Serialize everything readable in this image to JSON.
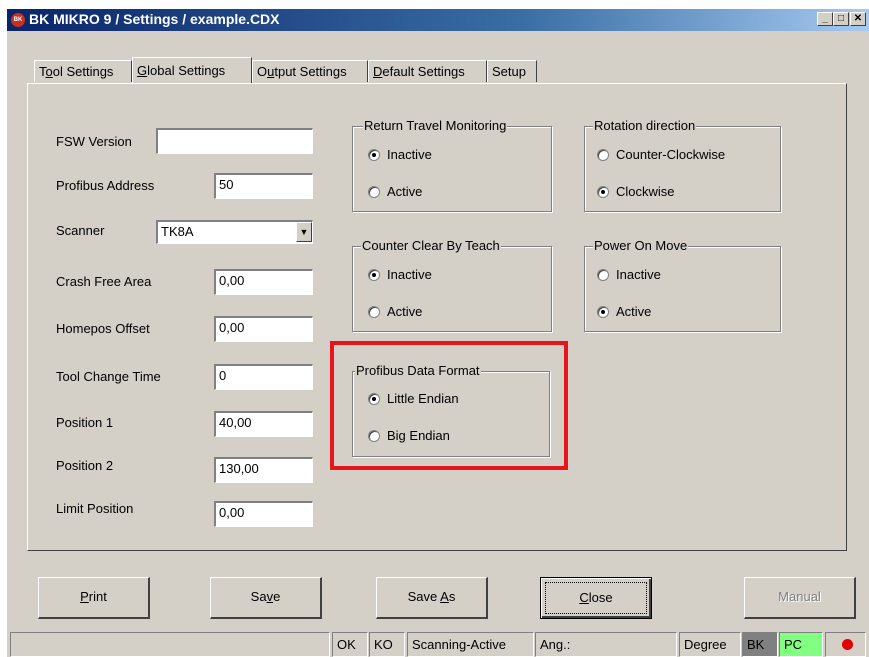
{
  "window": {
    "title": "BK MIKRO 9 / Settings / example.CDX",
    "icon": "bk-logo-icon",
    "minimize": "_",
    "maximize": "□",
    "close": "✕"
  },
  "tabs": [
    {
      "label": "Tool Settings",
      "mnemonic": "o"
    },
    {
      "label": "Global Settings",
      "mnemonic": "G"
    },
    {
      "label": "Output Settings",
      "mnemonic": "u"
    },
    {
      "label": "Default Settings",
      "mnemonic": "D"
    },
    {
      "label": "Setup"
    }
  ],
  "active_tab": "Global Settings",
  "fields": {
    "fsw_version": {
      "label": "FSW Version",
      "value": ""
    },
    "profibus_address": {
      "label": "Profibus Address",
      "value": "50"
    },
    "scanner": {
      "label": "Scanner",
      "value": "TK8A"
    },
    "crash_free_area": {
      "label": "Crash Free Area",
      "value": "0,00"
    },
    "homepos_offset": {
      "label": "Homepos Offset",
      "value": "0,00"
    },
    "tool_change_time": {
      "label": "Tool Change Time",
      "value": "0"
    },
    "position_1": {
      "label": "Position 1",
      "value": "40,00"
    },
    "position_2": {
      "label": "Position 2",
      "value": "130,00"
    },
    "limit_position": {
      "label": "Limit Position",
      "value": "0,00"
    }
  },
  "groups": {
    "return_travel": {
      "title": "Return Travel Monitoring",
      "options": [
        "Inactive",
        "Active"
      ],
      "selected": "Inactive"
    },
    "rotation": {
      "title": "Rotation direction",
      "options": [
        "Counter-Clockwise",
        "Clockwise"
      ],
      "selected": "Clockwise"
    },
    "counter_clear": {
      "title": "Counter Clear By Teach",
      "options": [
        "Inactive",
        "Active"
      ],
      "selected": "Inactive"
    },
    "power_on_move": {
      "title": "Power On Move",
      "options": [
        "Inactive",
        "Active"
      ],
      "selected": "Active"
    },
    "profibus_format": {
      "title": "Profibus Data Format",
      "options": [
        "Little Endian",
        "Big Endian"
      ],
      "selected": "Little Endian"
    }
  },
  "buttons": {
    "print": {
      "pre": "",
      "u": "P",
      "post": "rint"
    },
    "save": {
      "pre": "Sa",
      "u": "v",
      "post": "e"
    },
    "save_as": {
      "pre": "Save ",
      "u": "A",
      "post": "s"
    },
    "close": {
      "pre": "",
      "u": "C",
      "post": "lose"
    },
    "manual": {
      "pre": "",
      "u": "",
      "post": "Manual"
    }
  },
  "statusbar": {
    "ok": "OK",
    "ko": "KO",
    "scanning": "Scanning-Active",
    "angle": "Ang.:",
    "unit": "Degree",
    "bk": "BK",
    "pc": "PC",
    "colors": {
      "bk_bg": "#808080",
      "pc_bg": "#80ff80",
      "led": "#e00000"
    }
  },
  "highlight_color": "#e8141c"
}
